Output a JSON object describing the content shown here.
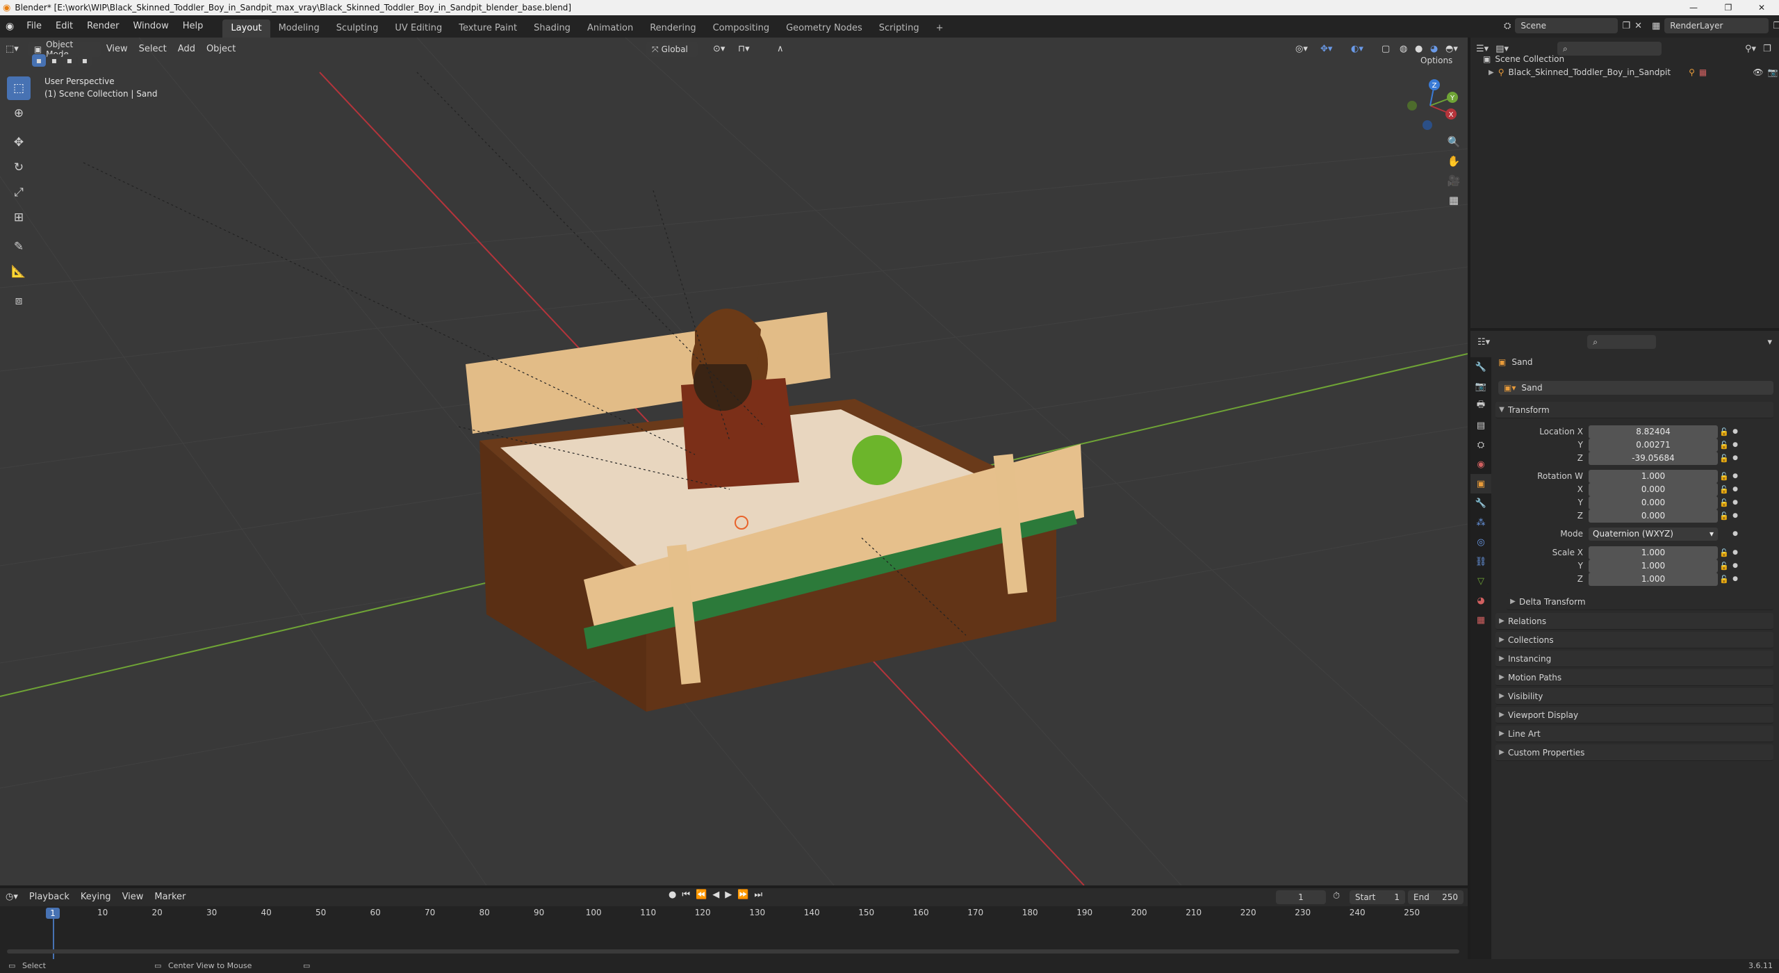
{
  "window": {
    "title": "Blender* [E:\\work\\WIP\\Black_Skinned_Toddler_Boy_in_Sandpit_max_vray\\Black_Skinned_Toddler_Boy_in_Sandpit_blender_base.blend]"
  },
  "menu": [
    "File",
    "Edit",
    "Render",
    "Window",
    "Help"
  ],
  "workspaces": [
    "Layout",
    "Modeling",
    "Sculpting",
    "UV Editing",
    "Texture Paint",
    "Shading",
    "Animation",
    "Rendering",
    "Compositing",
    "Geometry Nodes",
    "Scripting"
  ],
  "scene": {
    "name": "Scene",
    "render_layer": "RenderLayer"
  },
  "viewport": {
    "mode": "Object Mode",
    "menus": [
      "View",
      "Select",
      "Add",
      "Object"
    ],
    "orientation": "Global",
    "options_label": "Options",
    "overlay_title": "User Perspective",
    "overlay_subtitle": "(1) Scene Collection | Sand",
    "gizmo": {
      "x": "X",
      "y": "Y",
      "z": "Z"
    }
  },
  "outliner": {
    "root": "Scene Collection",
    "items": [
      "Black_Skinned_Toddler_Boy_in_Sandpit"
    ]
  },
  "properties": {
    "object_name": "Sand",
    "data_name": "Sand",
    "transform_label": "Transform",
    "location": {
      "label": "Location X",
      "x": "8.82404",
      "y": "0.00271",
      "z": "-39.05684"
    },
    "rotation": {
      "label": "Rotation W",
      "w": "1.000",
      "x": "0.000",
      "y": "0.000",
      "z": "0.000"
    },
    "mode": {
      "label": "Mode",
      "value": "Quaternion (WXYZ)"
    },
    "scale": {
      "label": "Scale X",
      "x": "1.000",
      "y": "1.000",
      "z": "1.000"
    },
    "axis_labels": {
      "x": "X",
      "y": "Y",
      "z": "Z"
    },
    "delta_transform": "Delta Transform",
    "panels": [
      "Relations",
      "Collections",
      "Instancing",
      "Motion Paths",
      "Visibility",
      "Viewport Display",
      "Line Art",
      "Custom Properties"
    ]
  },
  "timeline": {
    "menus": [
      "Playback",
      "Keying",
      "View",
      "Marker"
    ],
    "current_frame": "1",
    "start_label": "Start",
    "start": "1",
    "end_label": "End",
    "end": "250",
    "ticks": [
      "10",
      "20",
      "30",
      "40",
      "50",
      "60",
      "70",
      "80",
      "90",
      "100",
      "110",
      "120",
      "130",
      "140",
      "150",
      "160",
      "170",
      "180",
      "190",
      "200",
      "210",
      "220",
      "230",
      "240",
      "250"
    ]
  },
  "status": {
    "select": "Select",
    "center_view": "Center View to Mouse",
    "version": "3.6.11"
  },
  "colors": {
    "accent": "#4772b3",
    "viewport_bg": "#393939",
    "panel_bg": "#2b2b2b",
    "x_axis": "#b5343b",
    "y_axis": "#6fa436",
    "z_axis": "#3a7bd6"
  }
}
